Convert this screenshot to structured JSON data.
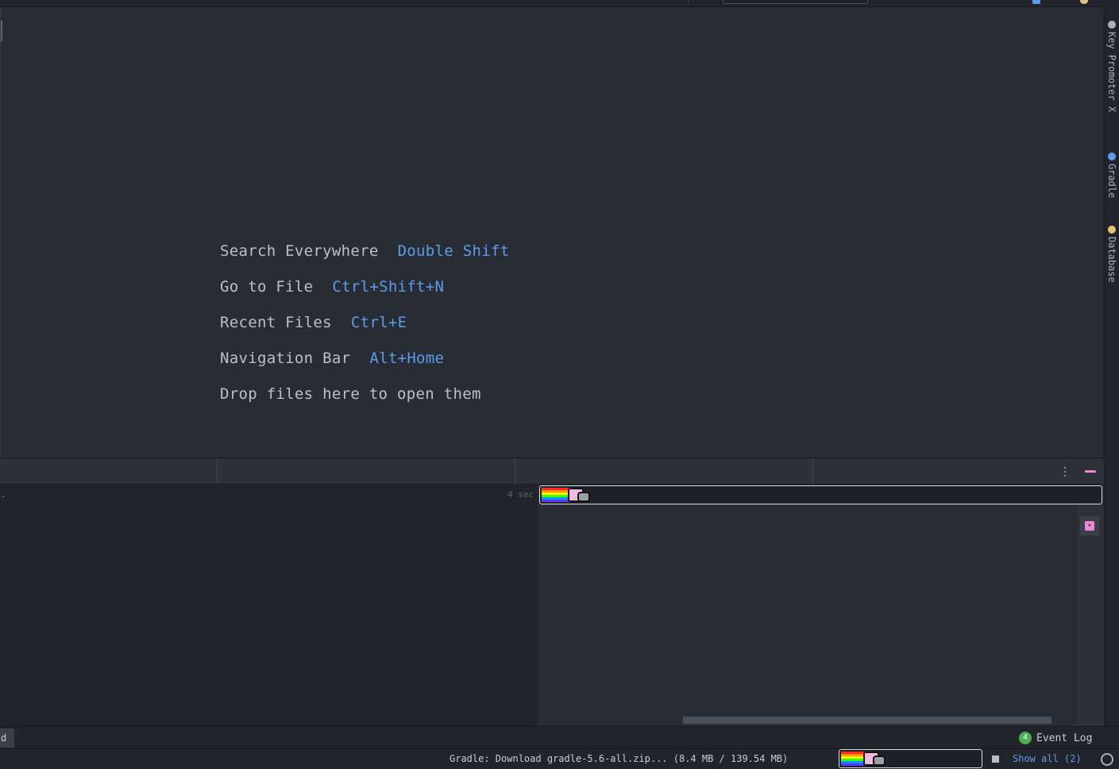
{
  "editor": {
    "hints": [
      {
        "action": "Search Everywhere",
        "shortcut": "Double Shift"
      },
      {
        "action": "Go to File",
        "shortcut": "Ctrl+Shift+N"
      },
      {
        "action": "Recent Files",
        "shortcut": "Ctrl+E"
      },
      {
        "action": "Navigation Bar",
        "shortcut": "Alt+Home"
      }
    ],
    "drop_text": "Drop files here to open them"
  },
  "right_strip": {
    "tabs": [
      "Key Promoter X",
      "Gradle",
      "Database"
    ]
  },
  "build_panel": {
    "row_text": ".",
    "elapsed": "4 sec",
    "progress_fraction": 0.05
  },
  "bottom_tabs": {
    "left_stub": "d",
    "event_log_label": "Event Log",
    "event_log_count": "4"
  },
  "status": {
    "message": "Gradle: Download gradle-5.6-all.zip...  (8.4 MB / 139.54 MB)",
    "show_all": "Show all (2)",
    "progress_fraction": 0.06
  },
  "colors": {
    "accent": "#5c9ded",
    "pink": "#e88bd2",
    "background": "#282c34",
    "rainbow": [
      "#ff2a2a",
      "#ff9a00",
      "#ffee00",
      "#33ff00",
      "#0099ff",
      "#6633ff"
    ]
  }
}
